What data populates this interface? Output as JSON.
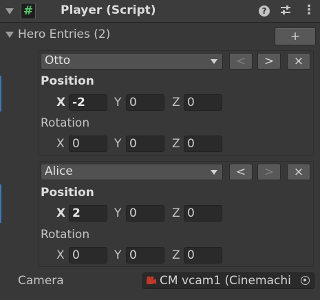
{
  "header": {
    "title": "Player (Script)",
    "script_glyph": "#",
    "help_glyph": "?",
    "settings_glyph": "⚙",
    "menu_glyph": "⋮"
  },
  "list": {
    "label": "Hero Entries (2)",
    "add_label": "+",
    "entries": [
      {
        "name": "Otto",
        "prev_label": "<",
        "next_label": ">",
        "remove_label": "×",
        "position_label": "Position",
        "rotation_label": "Rotation",
        "position": {
          "x": "-2",
          "y": "0",
          "z": "0"
        },
        "rotation": {
          "x": "0",
          "y": "0",
          "z": "0"
        }
      },
      {
        "name": "Alice",
        "prev_label": "<",
        "next_label": ">",
        "remove_label": "×",
        "position_label": "Position",
        "rotation_label": "Rotation",
        "position": {
          "x": "2",
          "y": "0",
          "z": "0"
        },
        "rotation": {
          "x": "0",
          "y": "0",
          "z": "0"
        }
      }
    ]
  },
  "axes": {
    "x": "X",
    "y": "Y",
    "z": "Z"
  },
  "camera": {
    "label": "Camera",
    "value": "CM vcam1 (Cinemachi"
  }
}
